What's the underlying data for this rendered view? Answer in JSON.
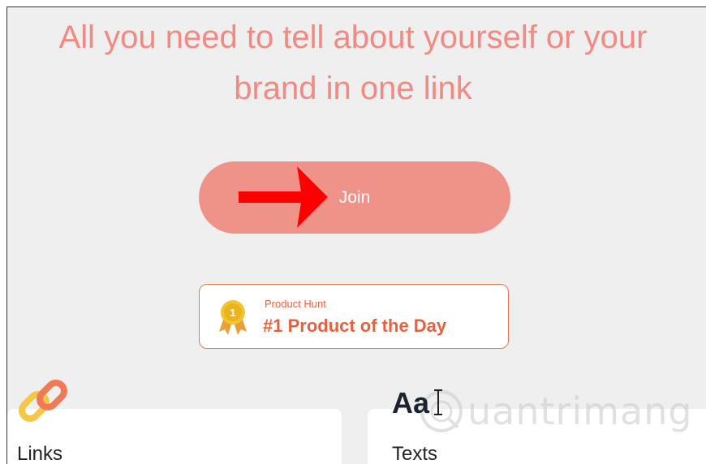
{
  "headline": {
    "line1": "All you need to tell about yourself or your",
    "line2": "brand in one link"
  },
  "join_button": {
    "label": "Join"
  },
  "product_hunt_badge": {
    "label": "Product Hunt",
    "title": "#1 Product of the Day",
    "medal_number": "1"
  },
  "features": [
    {
      "title": "Links",
      "icon": "chain-link-icon"
    },
    {
      "title": "Texts",
      "icon_text": "Aa"
    }
  ],
  "watermark": {
    "text": "uantrimang"
  },
  "colors": {
    "accent": "#f08a82",
    "button": "#ef938a",
    "badge": "#e8603c",
    "arrow": "#ff0000",
    "background": "#efefef"
  }
}
